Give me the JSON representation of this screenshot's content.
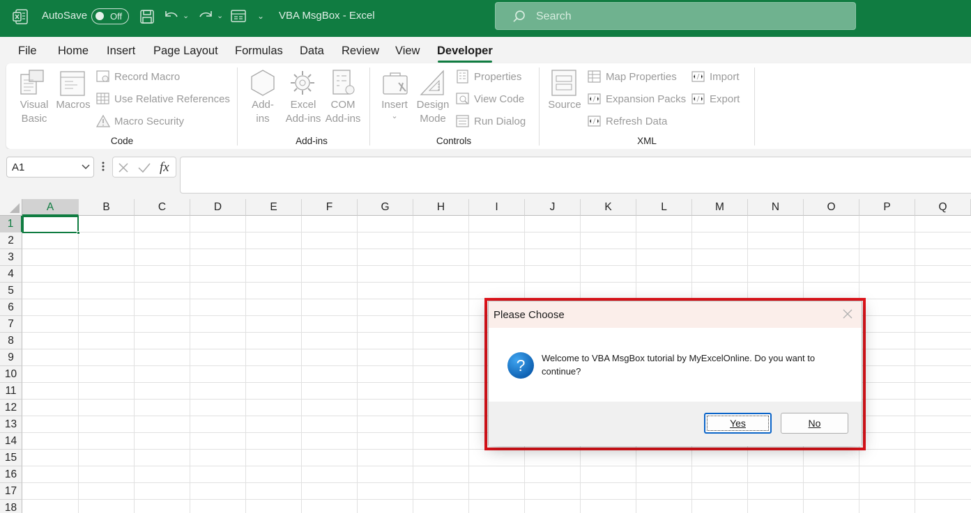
{
  "titlebar": {
    "autosave_label": "AutoSave",
    "autosave_state": "Off",
    "doc_title": "VBA MsgBox  -  Excel",
    "search_placeholder": "Search"
  },
  "menu": {
    "items": [
      "File",
      "Home",
      "Insert",
      "Page Layout",
      "Formulas",
      "Data",
      "Review",
      "View",
      "Developer"
    ],
    "active": "Developer"
  },
  "ribbon": {
    "code": {
      "group_label": "Code",
      "visual_basic": [
        "Visual",
        "Basic"
      ],
      "macros": "Macros",
      "record_macro": "Record Macro",
      "use_relative": "Use Relative References",
      "macro_security": "Macro Security"
    },
    "addins": {
      "group_label": "Add-ins",
      "add_ins": [
        "Add-",
        "ins"
      ],
      "excel_addins": [
        "Excel",
        "Add-ins"
      ],
      "com_addins": [
        "COM",
        "Add-ins"
      ]
    },
    "controls": {
      "group_label": "Controls",
      "insert": "Insert",
      "design_mode": [
        "Design",
        "Mode"
      ],
      "properties": "Properties",
      "view_code": "View Code",
      "run_dialog": "Run Dialog"
    },
    "xml": {
      "group_label": "XML",
      "source": "Source",
      "map_properties": "Map Properties",
      "expansion_packs": "Expansion Packs",
      "refresh_data": "Refresh Data",
      "import": "Import",
      "export": "Export"
    }
  },
  "formula_bar": {
    "name_box": "A1",
    "formula": ""
  },
  "sheet": {
    "columns": [
      "A",
      "B",
      "C",
      "D",
      "E",
      "F",
      "G",
      "H",
      "I",
      "J",
      "K",
      "L",
      "M",
      "N",
      "O",
      "P",
      "Q"
    ],
    "rows": [
      "1",
      "2",
      "3",
      "4",
      "5",
      "6",
      "7",
      "8",
      "9",
      "10",
      "11",
      "12",
      "13",
      "14",
      "15",
      "16",
      "17",
      "18"
    ],
    "selected_cell": "A1"
  },
  "dialog": {
    "title": "Please Choose",
    "message": "Welcome to VBA MsgBox tutorial by MyExcelOnline. Do you want to continue?",
    "yes_label": "Yes",
    "no_label": "No",
    "highlight_color": "#e3141b"
  },
  "colors": {
    "brand": "#107c41",
    "dialog_button_focus": "#0a64c8"
  }
}
